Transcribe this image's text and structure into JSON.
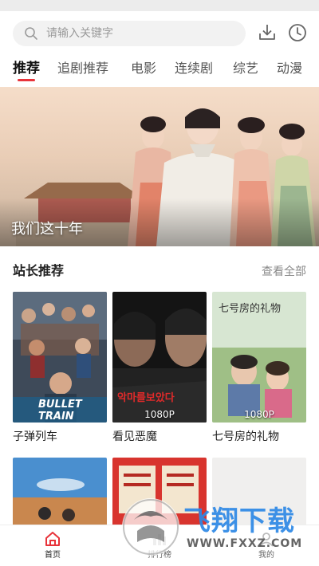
{
  "search": {
    "placeholder": "请输入关键字"
  },
  "toolbar": {
    "download_icon": "download-icon",
    "history_icon": "history-clock-icon"
  },
  "tabs": [
    {
      "label": "推荐",
      "active": true
    },
    {
      "label": "追剧推荐"
    },
    {
      "label": "电影"
    },
    {
      "label": "连续剧"
    },
    {
      "label": "综艺"
    },
    {
      "label": "动漫"
    }
  ],
  "banner": {
    "caption": "我们这十年",
    "slides": 3,
    "active_slide": 3
  },
  "section": {
    "title": "站长推荐",
    "more": "查看全部"
  },
  "cards": [
    {
      "title": "子弹列车",
      "poster_text": "BULLET TRAIN",
      "badge": ""
    },
    {
      "title": "看见恶魔",
      "poster_text": "악마를보았다",
      "badge": "1080P"
    },
    {
      "title": "七号房的礼物",
      "poster_text": "七号房的礼物",
      "badge": "1080P"
    }
  ],
  "tabbar": [
    {
      "label": "首页",
      "active": true
    },
    {
      "label": "排行榜"
    },
    {
      "label": "我的"
    }
  ],
  "watermark": {
    "brand": "飞翔下载",
    "url": "WWW.FXXZ.COM"
  },
  "colors": {
    "accent": "#e8333a",
    "watermark_blue": "#2d88e6"
  }
}
